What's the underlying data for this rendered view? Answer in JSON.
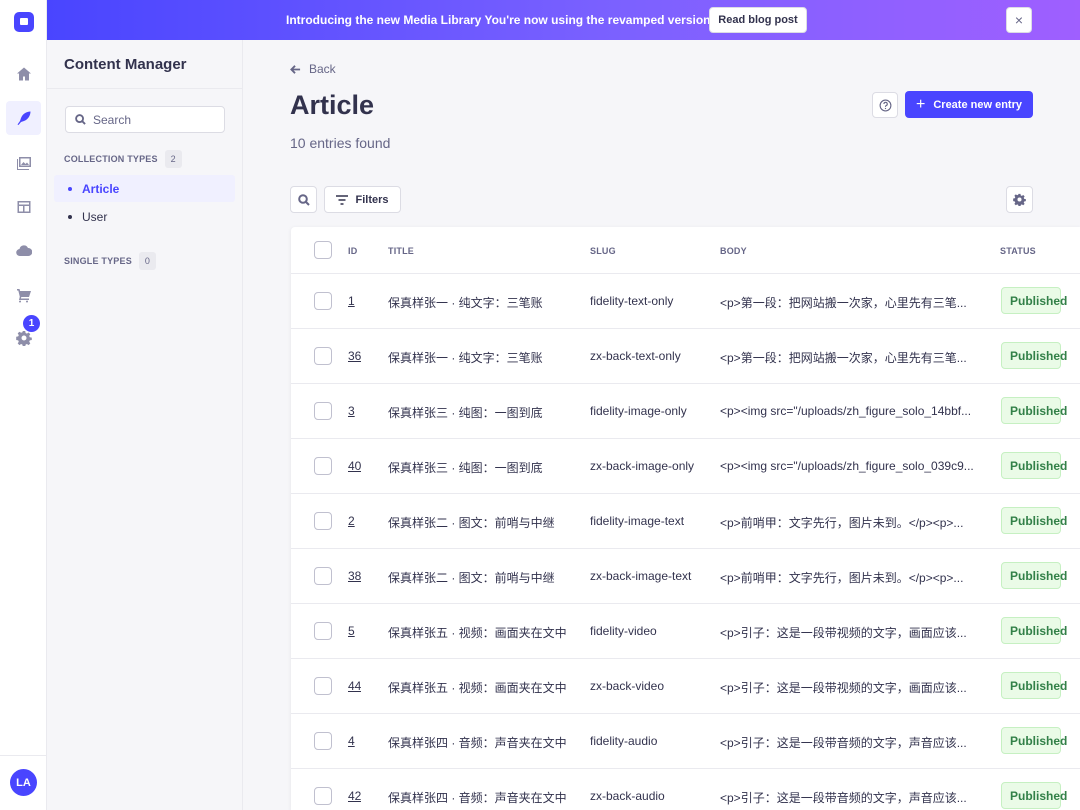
{
  "banner": {
    "text": "Introducing the new Media Library You're now using the revamped version.",
    "button_label": "Read blog post",
    "close_icon": "×"
  },
  "nav": {
    "badge_count": "1",
    "avatar_initials": "LA"
  },
  "sidebar": {
    "title": "Content Manager",
    "search_placeholder": "Search",
    "collection_types_label": "COLLECTION TYPES",
    "collection_types_count": "2",
    "collection_items": [
      {
        "label": "Article"
      },
      {
        "label": "User"
      }
    ],
    "single_types_label": "SINGLE TYPES",
    "single_types_count": "0"
  },
  "main": {
    "back_label": "Back",
    "title": "Article",
    "subtitle": "10 entries found",
    "create_label": "Create new entry",
    "filters_label": "Filters"
  },
  "table": {
    "headers": {
      "id": "ID",
      "title": "TITLE",
      "slug": "SLUG",
      "body": "BODY",
      "status": "STATUS"
    },
    "rows": [
      {
        "id": "1",
        "title": "保真样张一 · 纯文字：三笔账",
        "slug": "fidelity-text-only",
        "body": "<p>第一段：把网站搬一次家，心里先有三笔...",
        "status": "Published"
      },
      {
        "id": "36",
        "title": "保真样张一 · 纯文字：三笔账",
        "slug": "zx-back-text-only",
        "body": "<p>第一段：把网站搬一次家，心里先有三笔...",
        "status": "Published"
      },
      {
        "id": "3",
        "title": "保真样张三 · 纯图：一图到底",
        "slug": "fidelity-image-only",
        "body": "<p><img src=\"/uploads/zh_figure_solo_14bbf...",
        "status": "Published"
      },
      {
        "id": "40",
        "title": "保真样张三 · 纯图：一图到底",
        "slug": "zx-back-image-only",
        "body": "<p><img src=\"/uploads/zh_figure_solo_039c9...",
        "status": "Published"
      },
      {
        "id": "2",
        "title": "保真样张二 · 图文：前哨与中继",
        "slug": "fidelity-image-text",
        "body": "<p>前哨甲：文字先行，图片未到。</p><p>...",
        "status": "Published"
      },
      {
        "id": "38",
        "title": "保真样张二 · 图文：前哨与中继",
        "slug": "zx-back-image-text",
        "body": "<p>前哨甲：文字先行，图片未到。</p><p>...",
        "status": "Published"
      },
      {
        "id": "5",
        "title": "保真样张五 · 视频：画面夹在文中",
        "slug": "fidelity-video",
        "body": "<p>引子：这是一段带视频的文字，画面应该...",
        "status": "Published"
      },
      {
        "id": "44",
        "title": "保真样张五 · 视频：画面夹在文中",
        "slug": "zx-back-video",
        "body": "<p>引子：这是一段带视频的文字，画面应该...",
        "status": "Published"
      },
      {
        "id": "4",
        "title": "保真样张四 · 音频：声音夹在文中",
        "slug": "fidelity-audio",
        "body": "<p>引子：这是一段带音频的文字，声音应该...",
        "status": "Published"
      },
      {
        "id": "42",
        "title": "保真样张四 · 音频：声音夹在文中",
        "slug": "zx-back-audio",
        "body": "<p>引子：这是一段带音频的文字，声音应该...",
        "status": "Published"
      }
    ]
  },
  "colors": {
    "primary": "#4945ff",
    "success_text": "#328048",
    "success_bg": "#eafbe7"
  }
}
